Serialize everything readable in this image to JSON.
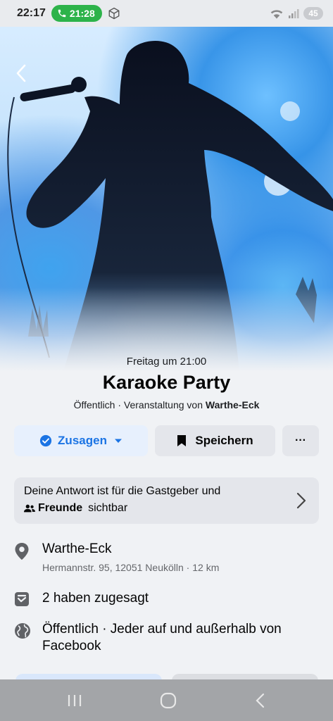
{
  "status_bar": {
    "time": "22:17",
    "call_timer": "21:28",
    "battery": "45",
    "icons": [
      "phone-icon",
      "cube-icon",
      "wifi-icon",
      "signal-icon"
    ]
  },
  "event": {
    "date": "Freitag um 21:00",
    "title": "Karaoke Party",
    "visibility_prefix": "Öffentlich · Veranstaltung von ",
    "host": "Warthe-Eck"
  },
  "actions": {
    "going_label": "Zusagen",
    "save_label": "Speichern",
    "more_label": "···"
  },
  "response_info": {
    "line1": "Deine Antwort ist für die Gastgeber und",
    "friends": "Freunde",
    "line2_suffix": "sichtbar"
  },
  "details": {
    "location_name": "Warthe-Eck",
    "location_address": "Hermannstr. 95, 12051 Neukölln · 12 km",
    "attendees": "2 haben zugesagt",
    "privacy": "Öffentlich · Jeder auf und außerhalb von Facebook"
  },
  "colors": {
    "accent": "#1b74e4",
    "going_bg": "#e7f0fd",
    "button_bg": "#e4e6eb",
    "page_bg": "#f0f2f5"
  }
}
